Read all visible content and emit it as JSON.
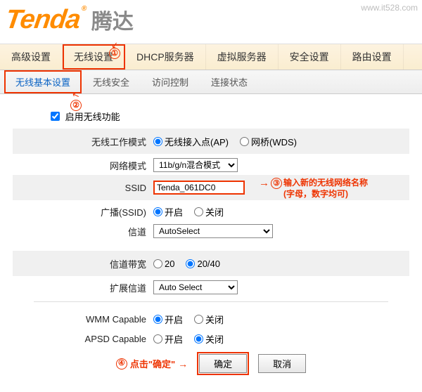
{
  "watermark": "www.it528.com",
  "brand": {
    "en": "Tenda",
    "cn": "腾达"
  },
  "main_nav": {
    "items": [
      "高级设置",
      "无线设置",
      "DHCP服务器",
      "虚拟服务器",
      "安全设置",
      "路由设置"
    ],
    "selected_index": 1
  },
  "sub_nav": {
    "items": [
      "无线基本设置",
      "无线安全",
      "访问控制",
      "连接状态"
    ],
    "active_index": 0
  },
  "enable_row": {
    "label": "启用无线功能",
    "checked": true
  },
  "rows": {
    "work_mode": {
      "label": "无线工作模式",
      "opt_ap": "无线接入点(AP)",
      "opt_wds": "网桥(WDS)",
      "value": "ap"
    },
    "net_mode": {
      "label": "网络模式",
      "select_value": "11b/g/n混合模式"
    },
    "ssid": {
      "label": "SSID",
      "value": "Tenda_061DC0"
    },
    "broadcast": {
      "label": "广播(SSID)",
      "on": "开启",
      "off": "关闭",
      "value": "on"
    },
    "channel": {
      "label": "信道",
      "select_value": "AutoSelect"
    },
    "bandwidth": {
      "label": "信道带宽",
      "opt20": "20",
      "opt2040": "20/40",
      "value": "2040"
    },
    "ext_chan": {
      "label": "扩展信道",
      "select_value": "Auto Select"
    },
    "wmm": {
      "label": "WMM Capable",
      "on": "开启",
      "off": "关闭",
      "value": "on"
    },
    "apsd": {
      "label": "APSD Capable",
      "on": "开启",
      "off": "关闭",
      "value": "off"
    }
  },
  "buttons": {
    "ok": "确定",
    "cancel": "取消"
  },
  "annotations": {
    "c1": "①",
    "c2": "②",
    "c3": "③",
    "c4": "④",
    "ssid_hint_line1": "输入新的无线网络名称",
    "ssid_hint_line2": "(字母，数字均可)",
    "btn_hint": "点击\"确定\""
  }
}
